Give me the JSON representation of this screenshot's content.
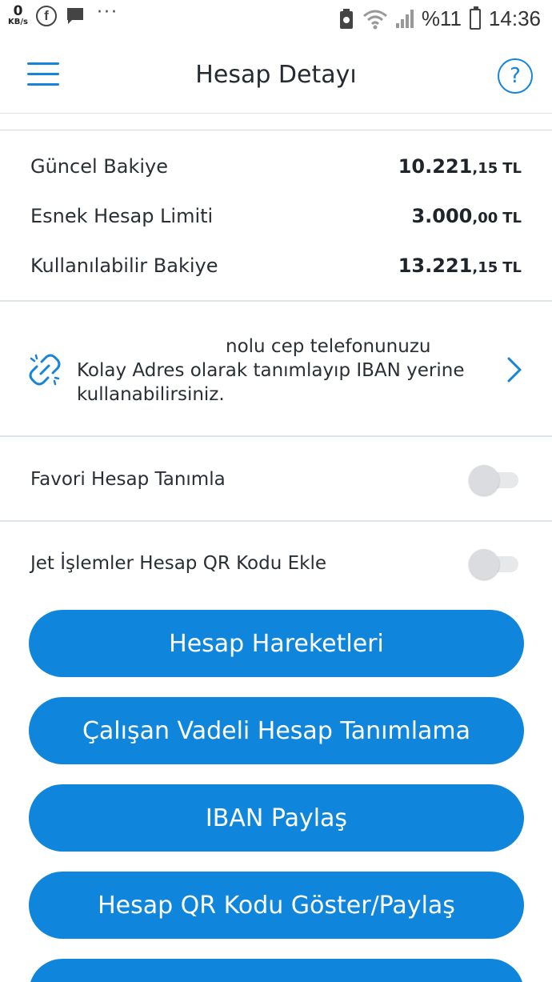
{
  "status_bar": {
    "net_speed": "0",
    "net_unit": "KB/s",
    "facebook_glyph": "f",
    "more_glyph": "···",
    "battery_pct": "%11",
    "time": "14:36"
  },
  "header": {
    "title": "Hesap Detayı",
    "help_glyph": "?"
  },
  "balances": [
    {
      "label": "Güncel Bakiye",
      "int": "10.221",
      "dec": ",15",
      "cur": "TL"
    },
    {
      "label": "Esnek Hesap Limiti",
      "int": "3.000",
      "dec": ",00",
      "cur": "TL"
    },
    {
      "label": "Kullanılabilir Bakiye",
      "int": "13.221",
      "dec": ",15",
      "cur": "TL"
    }
  ],
  "info": {
    "line1": "nolu cep telefonunuzu",
    "line2": "Kolay Adres olarak tanımlayıp IBAN yerine",
    "line3": "kullanabilirsiniz."
  },
  "toggles": [
    {
      "label": "Favori Hesap Tanımla",
      "on": false
    },
    {
      "label": "Jet İşlemler Hesap QR Kodu Ekle",
      "on": false
    }
  ],
  "buttons": [
    {
      "label": "Hesap Hareketleri"
    },
    {
      "label": "Çalışan Vadeli Hesap Tanımlama"
    },
    {
      "label": "IBAN Paylaş"
    },
    {
      "label": "Hesap QR Kodu Göster/Paylaş"
    },
    {
      "label": ""
    }
  ],
  "colors": {
    "accent": "#1684d8",
    "button": "#0f86db",
    "text": "#262b33"
  }
}
